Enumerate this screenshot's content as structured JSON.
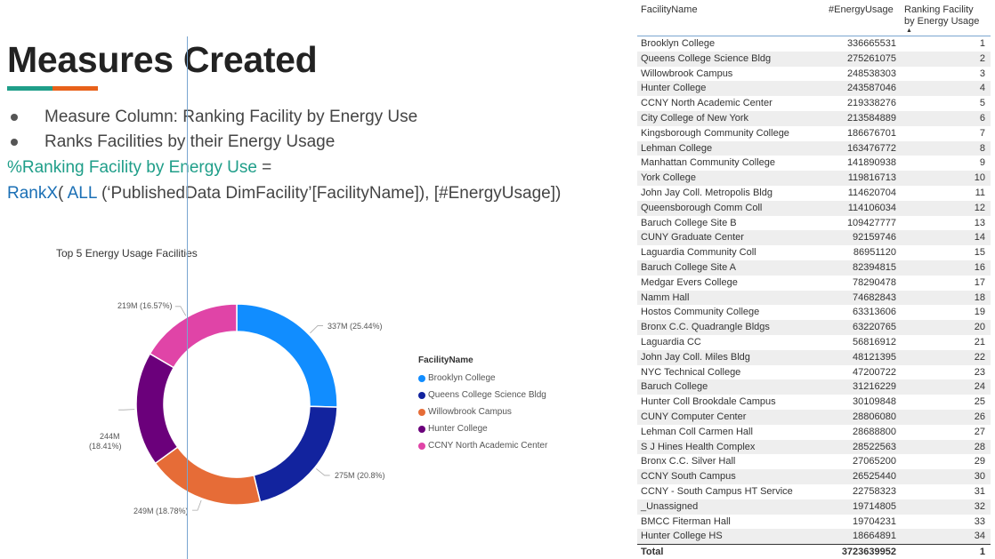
{
  "slide": {
    "title": "Measures Created",
    "bullets": [
      "Measure Column: Ranking Facility by Energy Use",
      "Ranks Facilities by their Energy Usage"
    ],
    "formula": {
      "line1_measure": "%Ranking Facility by Energy Use",
      "line1_eq": " =",
      "line2_func": "RankX",
      "line2_open": "( ",
      "line2_all": "ALL",
      "line2_rest": " (‘PublishedData DimFacility’[FacilityName]), [#EnergyUsage])"
    },
    "accent_colors": [
      "#1f9e89",
      "#e8611a"
    ]
  },
  "chart_data": {
    "type": "pie",
    "title": "Top 5 Energy Usage Facilities",
    "legend_title": "FacilityName",
    "legend_position": "right",
    "categories": [
      "Brooklyn College",
      "Queens College Science Bldg",
      "Willowbrook Campus",
      "Hunter College",
      "CCNY  North Academic Center"
    ],
    "values": [
      336665531,
      275261075,
      248538303,
      243587046,
      219338276
    ],
    "labels": [
      "337M (25.44%)",
      "275M (20.8%)",
      "249M (18.78%)",
      [
        "244M",
        "(18.41%)"
      ],
      "219M (16.57%)"
    ],
    "colors": [
      "#118dff",
      "#12239e",
      "#e66c37",
      "#6b007b",
      "#e044a7"
    ]
  },
  "table": {
    "headers": {
      "name": "FacilityName",
      "usage": "#EnergyUsage",
      "rank_line1": "Ranking Facility",
      "rank_line2": "by Energy Usage"
    },
    "rows": [
      {
        "name": "Brooklyn College",
        "usage": "336665531",
        "rank": "1"
      },
      {
        "name": "Queens College Science Bldg",
        "usage": "275261075",
        "rank": "2"
      },
      {
        "name": "Willowbrook Campus",
        "usage": "248538303",
        "rank": "3"
      },
      {
        "name": "Hunter College",
        "usage": "243587046",
        "rank": "4"
      },
      {
        "name": "CCNY North Academic Center",
        "usage": "219338276",
        "rank": "5"
      },
      {
        "name": "City College of New York",
        "usage": "213584889",
        "rank": "6"
      },
      {
        "name": "Kingsborough Community College",
        "usage": "186676701",
        "rank": "7"
      },
      {
        "name": "Lehman College",
        "usage": "163476772",
        "rank": "8"
      },
      {
        "name": "Manhattan Community College",
        "usage": "141890938",
        "rank": "9"
      },
      {
        "name": "York College",
        "usage": "119816713",
        "rank": "10"
      },
      {
        "name": "John Jay Coll. Metropolis Bldg",
        "usage": "114620704",
        "rank": "11"
      },
      {
        "name": "Queensborough Comm Coll",
        "usage": "114106034",
        "rank": "12"
      },
      {
        "name": "Baruch College Site B",
        "usage": "109427777",
        "rank": "13"
      },
      {
        "name": "CUNY Graduate Center",
        "usage": "92159746",
        "rank": "14"
      },
      {
        "name": "Laguardia Community Coll",
        "usage": "86951120",
        "rank": "15"
      },
      {
        "name": "Baruch College Site A",
        "usage": "82394815",
        "rank": "16"
      },
      {
        "name": "Medgar Evers College",
        "usage": "78290478",
        "rank": "17"
      },
      {
        "name": "Namm Hall",
        "usage": "74682843",
        "rank": "18"
      },
      {
        "name": "Hostos Community College",
        "usage": "63313606",
        "rank": "19"
      },
      {
        "name": "Bronx C.C. Quadrangle Bldgs",
        "usage": "63220765",
        "rank": "20"
      },
      {
        "name": "Laguardia CC",
        "usage": "56816912",
        "rank": "21"
      },
      {
        "name": "John Jay Coll. Miles Bldg",
        "usage": "48121395",
        "rank": "22"
      },
      {
        "name": "NYC Technical College",
        "usage": "47200722",
        "rank": "23"
      },
      {
        "name": "Baruch College",
        "usage": "31216229",
        "rank": "24"
      },
      {
        "name": "Hunter Coll Brookdale Campus",
        "usage": "30109848",
        "rank": "25"
      },
      {
        "name": "CUNY Computer Center",
        "usage": "28806080",
        "rank": "26"
      },
      {
        "name": "Lehman Coll Carmen Hall",
        "usage": "28688800",
        "rank": "27"
      },
      {
        "name": "S J Hines Health Complex",
        "usage": "28522563",
        "rank": "28"
      },
      {
        "name": "Bronx C.C. Silver Hall",
        "usage": "27065200",
        "rank": "29"
      },
      {
        "name": "CCNY South Campus",
        "usage": "26525440",
        "rank": "30"
      },
      {
        "name": "CCNY - South Campus HT Service",
        "usage": "22758323",
        "rank": "31"
      },
      {
        "name": "_Unassigned",
        "usage": "19714805",
        "rank": "32"
      },
      {
        "name": "BMCC Fiterman Hall",
        "usage": "19704231",
        "rank": "33"
      },
      {
        "name": "Hunter College HS",
        "usage": "18664891",
        "rank": "34"
      }
    ],
    "total": {
      "name": "Total",
      "usage": "3723639952",
      "rank": "1"
    }
  }
}
